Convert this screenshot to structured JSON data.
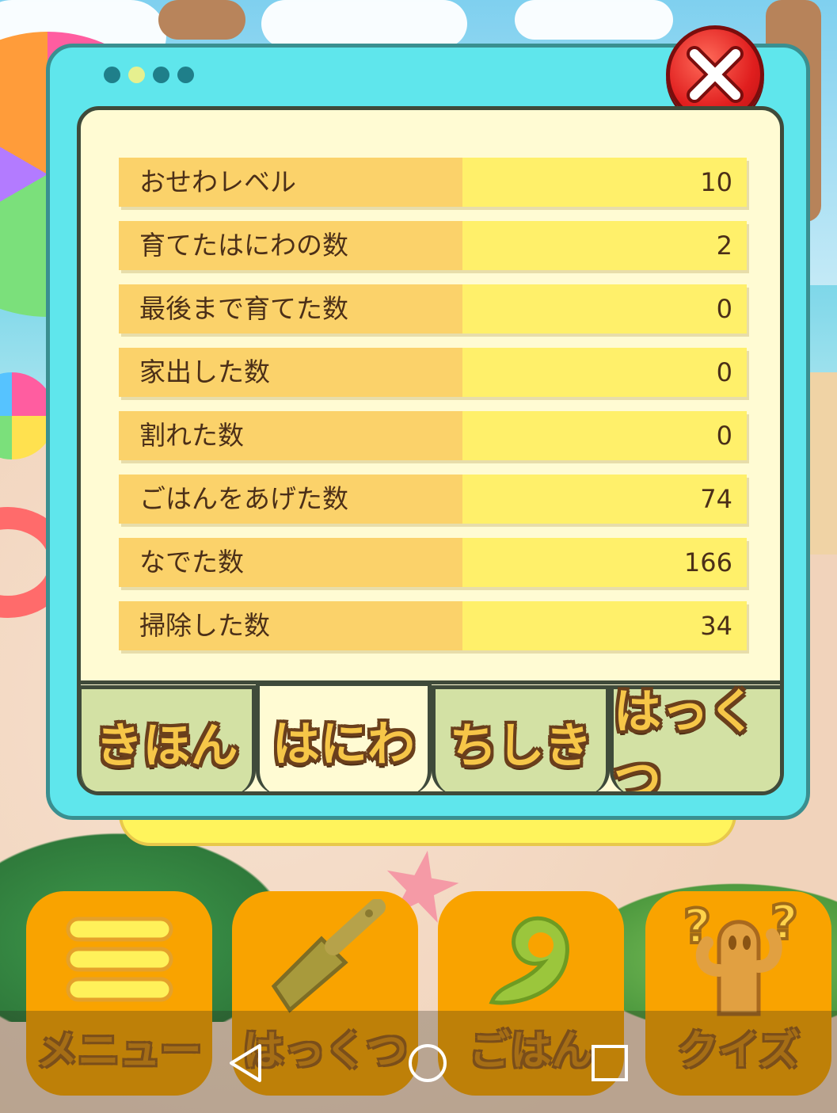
{
  "window": {
    "page_dots": [
      false,
      true,
      false,
      false
    ]
  },
  "stats": [
    {
      "label": "おせわレベル",
      "value": "10"
    },
    {
      "label": "育てたはにわの数",
      "value": "2"
    },
    {
      "label": "最後まで育てた数",
      "value": "0"
    },
    {
      "label": "家出した数",
      "value": "0"
    },
    {
      "label": "割れた数",
      "value": "0"
    },
    {
      "label": "ごはんをあげた数",
      "value": "74"
    },
    {
      "label": "なでた数",
      "value": "166"
    },
    {
      "label": "掃除した数",
      "value": "34"
    }
  ],
  "tabs": [
    {
      "label": "きほん",
      "active": false
    },
    {
      "label": "はにわ",
      "active": true
    },
    {
      "label": "ちしき",
      "active": false
    },
    {
      "label": "はっくつ",
      "active": false
    }
  ],
  "bottom_menu": [
    {
      "label": "メニュー",
      "icon": "menu-icon"
    },
    {
      "label": "はっくつ",
      "icon": "trowel-icon"
    },
    {
      "label": "ごはん",
      "icon": "food-icon"
    },
    {
      "label": "クイズ",
      "icon": "quiz-haniwa-icon"
    }
  ],
  "colors": {
    "panel": "#5fe6ec",
    "inner": "#fffbd3",
    "label_cell": "#fbd26a",
    "value_cell": "#fff06a",
    "close": "#e01e1e",
    "bottom_button": "#f9a300"
  },
  "system_nav": {
    "back": "back-icon",
    "home": "home-icon",
    "recents": "recents-icon"
  }
}
